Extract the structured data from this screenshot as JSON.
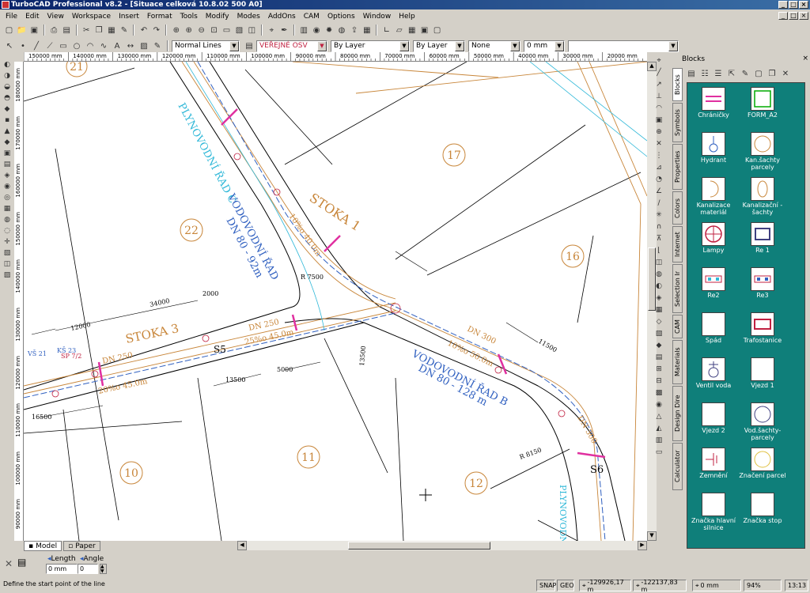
{
  "window": {
    "title": "TurboCAD Professional v8.2 - [Situace celková 10.8.02 500 A0]",
    "minimize": "_",
    "maximize": "□",
    "close": "×"
  },
  "menu": [
    "File",
    "Edit",
    "View",
    "Workspace",
    "Insert",
    "Format",
    "Tools",
    "Modify",
    "Modes",
    "AddOns",
    "CAM",
    "Options",
    "Window",
    "Help"
  ],
  "properties_bar": {
    "line_style": "Normal Lines",
    "layer": "VEŘEJNÉ OSV",
    "color": "By Layer",
    "width_style": "By Layer",
    "pattern": "None",
    "thickness": "0 mm"
  },
  "ruler_labels": [
    "150000 mm",
    "140000 mm",
    "130000 mm",
    "120000 mm",
    "110000 mm",
    "100000 mm",
    "90000 mm",
    "80000 mm",
    "70000 mm",
    "60000 mm",
    "50000 mm",
    "40000 mm",
    "30000 mm",
    "20000 mm"
  ],
  "vruler_labels": [
    "180000 mm",
    "170000 mm",
    "160000 mm",
    "150000 mm",
    "140000 mm",
    "130000 mm",
    "120000 mm",
    "110000 mm",
    "100000 mm",
    "90000 mm"
  ],
  "drawing": {
    "parcels": [
      "21",
      "17",
      "22",
      "16",
      "10",
      "11",
      "12"
    ],
    "labels": {
      "stoka1": "STOKA 1",
      "stoka3": "STOKA 3",
      "plyn_c": "PLYNOVODNÍ ŘAD C",
      "vod_c1": "VODOVODNÍ ŘAD",
      "vod_c2": "DN 80 - 92m",
      "vod_b1": "VODOVODNÍ ŘAD B",
      "vod_b2": "DN 80 - 128 m",
      "plyn_b": "PLYNOVODNÍ",
      "s6": "S6",
      "s5": "S5",
      "dn250a": "DN 250",
      "dn250b": "DN 250",
      "dn300": "DN 300",
      "dn300b": "DN 300",
      "slope1": "20%o 45.0m",
      "slope2": "25%o 45.0m",
      "slope3": "10%o 50.0m",
      "slope4": "10%o 40.0m",
      "dim1": "34000",
      "dim2": "12000",
      "dim3": "16500",
      "dim4": "13500",
      "dim5": "2000",
      "dim6": "5000",
      "dim7": "13500",
      "dim8": "11500",
      "r1": "R 7500",
      "r2": "R 8150",
      "ks1": "KŠ 23",
      "sp1": "SP 7/2",
      "vs1": "VŠ 21"
    }
  },
  "paper_tabs": [
    "Model",
    "Paper"
  ],
  "panel": {
    "title": "Blocks",
    "side_tabs": [
      "Blocks",
      "Symbols",
      "Properties",
      "Colors",
      "Internet",
      "Selection Ir",
      "CAM",
      "Materials",
      "Design Dire",
      "Calculator"
    ]
  },
  "blocks": [
    {
      "label": "Chráničky",
      "icon": "chranicky-icon"
    },
    {
      "label": "FORM_A2",
      "icon": "form-icon"
    },
    {
      "label": "Hydrant",
      "icon": "hydrant-icon"
    },
    {
      "label": "Kan.šachty parcely",
      "icon": "kan-sachty-icon"
    },
    {
      "label": "Kanalizace materiál",
      "icon": "kanalizace-icon"
    },
    {
      "label": "Kanalizační - šachty",
      "icon": "kan-sachty2-icon"
    },
    {
      "label": "Lampy",
      "icon": "lampy-icon"
    },
    {
      "label": "Re 1",
      "icon": "re1-icon"
    },
    {
      "label": "Re2",
      "icon": "re2-icon"
    },
    {
      "label": "Re3",
      "icon": "re3-icon"
    },
    {
      "label": "Spád",
      "icon": "spad-icon"
    },
    {
      "label": "Trafostanice",
      "icon": "trafostanice-icon"
    },
    {
      "label": "Ventil voda",
      "icon": "ventil-icon"
    },
    {
      "label": "Vjezd 1",
      "icon": "vjezd1-icon"
    },
    {
      "label": "Vjezd 2",
      "icon": "vjezd2-icon"
    },
    {
      "label": "Vod.šachty-parcely",
      "icon": "vod-sachty-icon"
    },
    {
      "label": "Zemnění",
      "icon": "zemneni-icon"
    },
    {
      "label": "Značení parcel",
      "icon": "znaceni-icon"
    },
    {
      "label": "Značka hlavní silnice",
      "icon": "hlavni-silnice-icon"
    },
    {
      "label": "Značka stop",
      "icon": "stop-icon"
    }
  ],
  "cmd": {
    "length_label": "Length",
    "angle_label": "Angle",
    "length_value": "0 mm",
    "angle_value": "0"
  },
  "status": {
    "prompt": "Define the start point of the line",
    "snap": "SNAP",
    "geo": "GEO",
    "x": "-129926,17 m",
    "y": "-122137,83 m",
    "z": "0 mm",
    "zoom": "94%",
    "time": "13:13"
  },
  "colors": {
    "orange": "#c8863a",
    "blue": "#3060c0",
    "cyan": "#30b8d8",
    "red": "#c02040",
    "magenta": "#e030a0",
    "teal": "#0f7f7a"
  }
}
